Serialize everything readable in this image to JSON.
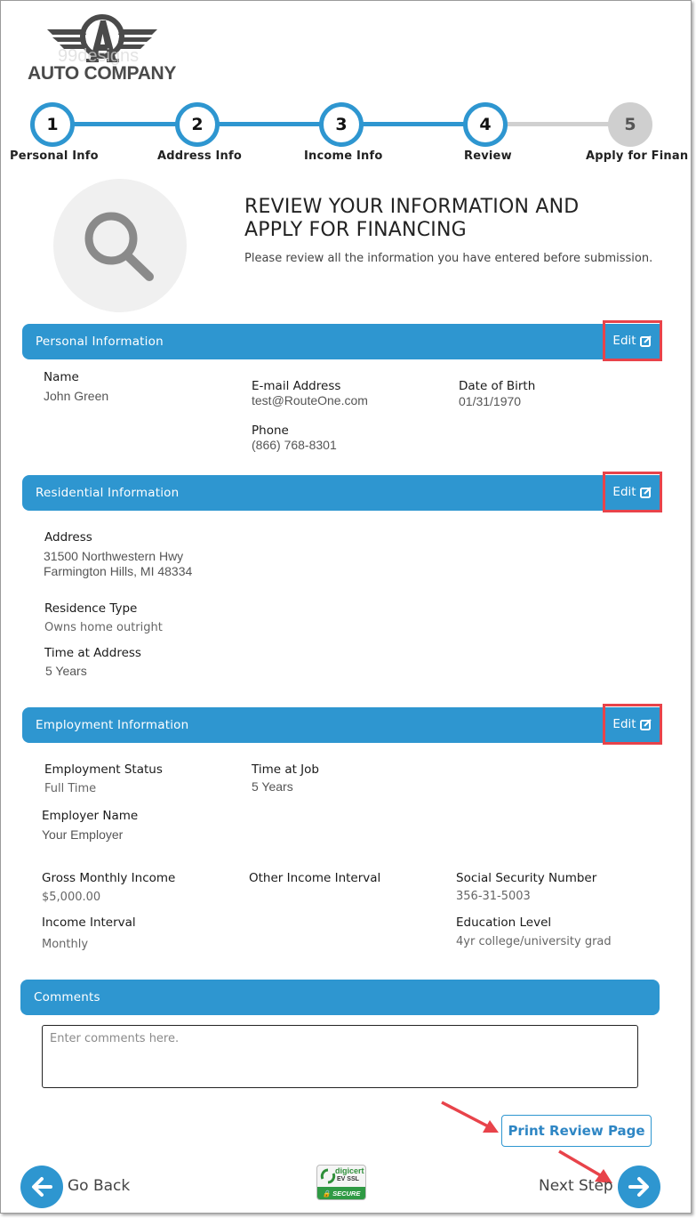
{
  "brand": {
    "logo_text": "AUTO COMPANY",
    "watermark": "99designs"
  },
  "stepper": {
    "steps": [
      {
        "number": "1",
        "label": "Personal Info",
        "state": "complete"
      },
      {
        "number": "2",
        "label": "Address Info",
        "state": "complete"
      },
      {
        "number": "3",
        "label": "Income Info",
        "state": "complete"
      },
      {
        "number": "4",
        "label": "Review",
        "state": "current"
      },
      {
        "number": "5",
        "label": "Apply for Finan",
        "state": "inactive"
      }
    ]
  },
  "intro": {
    "title_line1": "REVIEW YOUR INFORMATION AND",
    "title_line2": "APPLY FOR FINANCING",
    "subtitle": "Please review all the information you have entered before submission."
  },
  "personal": {
    "title": "Personal Information",
    "edit_label": "Edit",
    "name_label": "Name",
    "name_value": "John Green",
    "email_label": "E-mail Address",
    "email_value": "test@RouteOne.com",
    "dob_label": "Date of Birth",
    "dob_value": "01/31/1970",
    "phone_label": "Phone",
    "phone_value": "(866) 768-8301"
  },
  "residential": {
    "title": "Residential Information",
    "edit_label": "Edit",
    "address_label": "Address",
    "address_line1": "31500 Northwestern Hwy",
    "address_line2": "Farmington Hills, MI 48334",
    "residence_type_label": "Residence Type",
    "residence_type_value": "Owns home outright",
    "time_at_address_label": "Time at Address",
    "time_at_address_value": "5 Years"
  },
  "employment": {
    "title": "Employment Information",
    "edit_label": "Edit",
    "status_label": "Employment Status",
    "status_value": "Full Time",
    "time_at_job_label": "Time at Job",
    "time_at_job_value": "5 Years",
    "employer_label": "Employer Name",
    "employer_value": "Your Employer",
    "gross_income_label": "Gross Monthly Income",
    "gross_income_value": "$5,000.00",
    "other_income_interval_label": "Other Income Interval",
    "ssn_label": "Social Security Number",
    "ssn_value": "356-31-5003",
    "income_interval_label": "Income Interval",
    "income_interval_value": "Monthly",
    "education_label": "Education Level",
    "education_value": "4yr college/university grad"
  },
  "comments": {
    "title": "Comments",
    "placeholder": "Enter comments here.",
    "value": ""
  },
  "footer": {
    "print_label": "Print Review Page",
    "back_label": "Go Back",
    "next_label": "Next Step",
    "badge_brand": "digicert",
    "badge_type": "EV SSL",
    "badge_secure": "SECURE"
  },
  "colors": {
    "accent": "#2e96d0",
    "inactive_step": "#cfcfcf",
    "annotation_red": "#e8434a",
    "badge_green": "#2f9a44"
  }
}
